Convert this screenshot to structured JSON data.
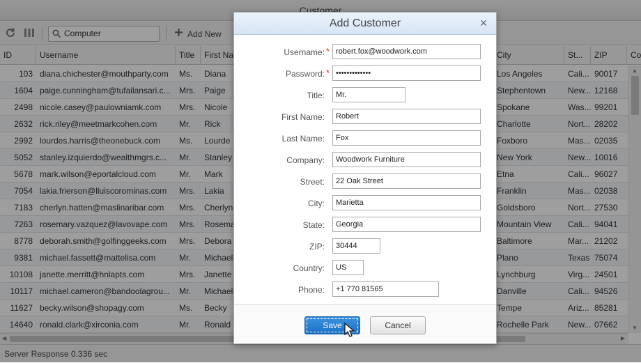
{
  "window": {
    "title": "Customer"
  },
  "toolbar": {
    "search_value": "Computer",
    "add_label": "Add New"
  },
  "columns": {
    "id": "ID",
    "username": "Username",
    "title": "Title",
    "first_name": "First Na",
    "city": "City",
    "state": "St...",
    "zip": "ZIP",
    "country": "Co"
  },
  "rows": [
    {
      "id": "103",
      "username": "diana.chichester@mouthparty.com",
      "title": "Ms.",
      "first_name": "Diana",
      "city": "Los Angeles",
      "state": "Cali...",
      "zip": "90017"
    },
    {
      "id": "1604",
      "username": "paige.cunningham@tufailansari.c...",
      "title": "Mrs.",
      "first_name": "Paige",
      "city": "Stephentown",
      "state": "New...",
      "zip": "12168"
    },
    {
      "id": "2498",
      "username": "nicole.casey@paulowniamk.com",
      "title": "Mrs.",
      "first_name": "Nicole",
      "city": "Spokane",
      "state": "Was...",
      "zip": "99201"
    },
    {
      "id": "2632",
      "username": "rick.riley@meetmarkcohen.com",
      "title": "Mr.",
      "first_name": "Rick",
      "city": "Charlotte",
      "state": "Nort...",
      "zip": "28202"
    },
    {
      "id": "2992",
      "username": "lourdes.harris@theonebuck.com",
      "title": "Ms.",
      "first_name": "Lourde",
      "city": "Foxboro",
      "state": "Mas...",
      "zip": "02035"
    },
    {
      "id": "5052",
      "username": "stanley.izquierdo@wealthmgrs.c...",
      "title": "Mr.",
      "first_name": "Stanley",
      "city": "New York",
      "state": "New...",
      "zip": "10016"
    },
    {
      "id": "5678",
      "username": "mark.wilson@eportalcloud.com",
      "title": "Mr.",
      "first_name": "Mark",
      "city": "Etna",
      "state": "Cali...",
      "zip": "96027"
    },
    {
      "id": "7054",
      "username": "lakia.frierson@lluiscorominas.com",
      "title": "Mrs.",
      "first_name": "Lakia",
      "city": "Franklin",
      "state": "Mas...",
      "zip": "02038"
    },
    {
      "id": "7183",
      "username": "cherlyn.hatten@maslinaribar.com",
      "title": "Mrs.",
      "first_name": "Cherlyn",
      "city": "Goldsboro",
      "state": "Nort...",
      "zip": "27530"
    },
    {
      "id": "7263",
      "username": "rosemary.vazquez@lavovape.com",
      "title": "Mrs.",
      "first_name": "Rosema",
      "city": "Mountain View",
      "state": "Cali...",
      "zip": "94041"
    },
    {
      "id": "8778",
      "username": "deborah.smith@golfinggeeks.com",
      "title": "Mrs.",
      "first_name": "Debora",
      "city": "Baltimore",
      "state": "Mar...",
      "zip": "21202"
    },
    {
      "id": "9381",
      "username": "michael.fassett@mattelisa.com",
      "title": "Mr.",
      "first_name": "Michael",
      "city": "Plano",
      "state": "Texas",
      "zip": "75074"
    },
    {
      "id": "10108",
      "username": "janette.merritt@hnlapts.com",
      "title": "Mrs.",
      "first_name": "Janette",
      "city": "Lynchburg",
      "state": "Virg...",
      "zip": "24501"
    },
    {
      "id": "10117",
      "username": "michael.cameron@bandoolagrou...",
      "title": "Mr.",
      "first_name": "Michael",
      "city": "Danville",
      "state": "Cali...",
      "zip": "94526"
    },
    {
      "id": "11627",
      "username": "becky.wilson@shopagy.com",
      "title": "Ms.",
      "first_name": "Becky",
      "city": "Tempe",
      "state": "Ariz...",
      "zip": "85281"
    },
    {
      "id": "14640",
      "username": "ronald.clark@xirconia.com",
      "title": "Mr.",
      "first_name": "Ronald",
      "city": "Rochelle Park",
      "state": "New...",
      "zip": "07662"
    }
  ],
  "status": {
    "text": "Server Response 0.336 sec"
  },
  "dialog": {
    "title": "Add Customer",
    "close_glyph": "×",
    "required_mark": "*",
    "fields": {
      "username": {
        "label": "Username:",
        "value": "robert.fox@woodwork.com"
      },
      "password": {
        "label": "Password:",
        "value": "•••••••••••••"
      },
      "title": {
        "label": "Title:",
        "value": "Mr."
      },
      "first_name": {
        "label": "First Name:",
        "value": "Robert"
      },
      "last_name": {
        "label": "Last Name:",
        "value": "Fox"
      },
      "company": {
        "label": "Company:",
        "value": "Woodwork Furniture"
      },
      "street": {
        "label": "Street:",
        "value": "22 Oak Street"
      },
      "city": {
        "label": "City:",
        "value": "Marietta"
      },
      "state": {
        "label": "State:",
        "value": "Georgia"
      },
      "zip": {
        "label": "ZIP:",
        "value": "30444"
      },
      "country": {
        "label": "Country:",
        "value": "US"
      },
      "phone": {
        "label": "Phone:",
        "value": "+1 770 81565"
      }
    },
    "save_label": "Save",
    "cancel_label": "Cancel"
  },
  "colors": {
    "save_button": "#2a7fd1",
    "required_star": "#d33333",
    "dialog_header": "#dde9f6",
    "overlay": "#000000"
  }
}
